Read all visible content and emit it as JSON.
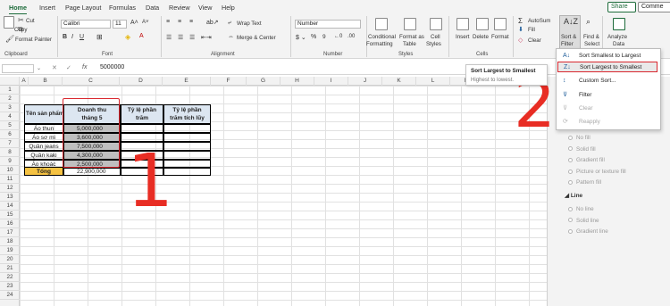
{
  "tabs": [
    "Home",
    "Insert",
    "Page Layout",
    "Formulas",
    "Data",
    "Review",
    "View",
    "Help"
  ],
  "share_label": "Share",
  "comments_label": "Comme",
  "clipboard": {
    "cut": "Cut",
    "copy": "Copy",
    "format_painter": "Format Painter",
    "group": "Clipboard"
  },
  "font": {
    "name": "Calibri",
    "size": "11",
    "group": "Font"
  },
  "alignment": {
    "wrap": "Wrap Text",
    "merge": "Merge & Center",
    "group": "Alignment"
  },
  "number": {
    "format": "Number",
    "group": "Number"
  },
  "styles": {
    "conditional": [
      "Conditional",
      "Formatting"
    ],
    "format_table": [
      "Format as",
      "Table"
    ],
    "cell_styles": [
      "Cell",
      "Styles"
    ],
    "group": "Styles"
  },
  "cells": {
    "insert": "Insert",
    "delete": "Delete",
    "format": "Format",
    "group": "Cells"
  },
  "editing": {
    "autosum": "AutoSum",
    "fill": "Fill",
    "clear": "Clear",
    "sort": [
      "Sort &",
      "Filter"
    ],
    "find": [
      "Find &",
      "Select"
    ]
  },
  "analyze": [
    "Analyze",
    "Data"
  ],
  "formula_bar": {
    "fx": "fx",
    "value": "5000000"
  },
  "columns": [
    "A",
    "B",
    "C",
    "D",
    "E",
    "F",
    "G",
    "H",
    "I",
    "J",
    "K",
    "L",
    "M",
    "N",
    "O"
  ],
  "rows": [
    "1",
    "2",
    "3",
    "4",
    "5",
    "6",
    "7",
    "8",
    "9",
    "10",
    "11",
    "12",
    "13",
    "14",
    "15",
    "16",
    "17",
    "18",
    "19",
    "20",
    "21",
    "22",
    "23",
    "24"
  ],
  "table": {
    "headers": [
      "Tên sản phẩm",
      "Doanh thu tháng 5",
      "Tỷ lệ phần trăm",
      "Tỷ lệ phần trăm tích lũy"
    ],
    "items": [
      {
        "name": "Áo thun",
        "value": "5,000,000"
      },
      {
        "name": "Áo sơ mi",
        "value": "3,600,000"
      },
      {
        "name": "Quần jeans",
        "value": "7,500,000"
      },
      {
        "name": "Quần kaki",
        "value": "4,300,000"
      },
      {
        "name": "Áo khoác",
        "value": "2,500,000"
      }
    ],
    "total_label": "Tổng",
    "total_value": "22,900,000"
  },
  "tooltip": {
    "title": "Sort Largest to Smallest",
    "desc": "Highest to lowest."
  },
  "menu": {
    "items": [
      {
        "label": "Sort Smallest to Largest",
        "icon": "sort-ascending-icon",
        "disabled": false
      },
      {
        "label": "Sort Largest to Smallest",
        "icon": "sort-descending-icon",
        "disabled": false
      },
      {
        "label": "Custom Sort...",
        "icon": "custom-sort-icon",
        "disabled": false
      },
      {
        "label": "Filter",
        "icon": "filter-icon",
        "disabled": false
      },
      {
        "label": "Clear",
        "icon": "clear-filter-icon",
        "disabled": true
      },
      {
        "label": "Reapply",
        "icon": "reapply-icon",
        "disabled": true
      }
    ]
  },
  "pane": {
    "fill_options": [
      "No fill",
      "Solid fill",
      "Gradient fill",
      "Picture or texture fill",
      "Pattern fill"
    ],
    "line_heading": "Line",
    "line_options": [
      "No line",
      "Solid line",
      "Gradient line"
    ]
  },
  "annotations": {
    "one": "1",
    "two": "2"
  },
  "colors": {
    "accent": "#1d6b3a",
    "annotation": "#e82d24",
    "header_fill": "#dce6f1",
    "total_fill": "#f5c242"
  }
}
